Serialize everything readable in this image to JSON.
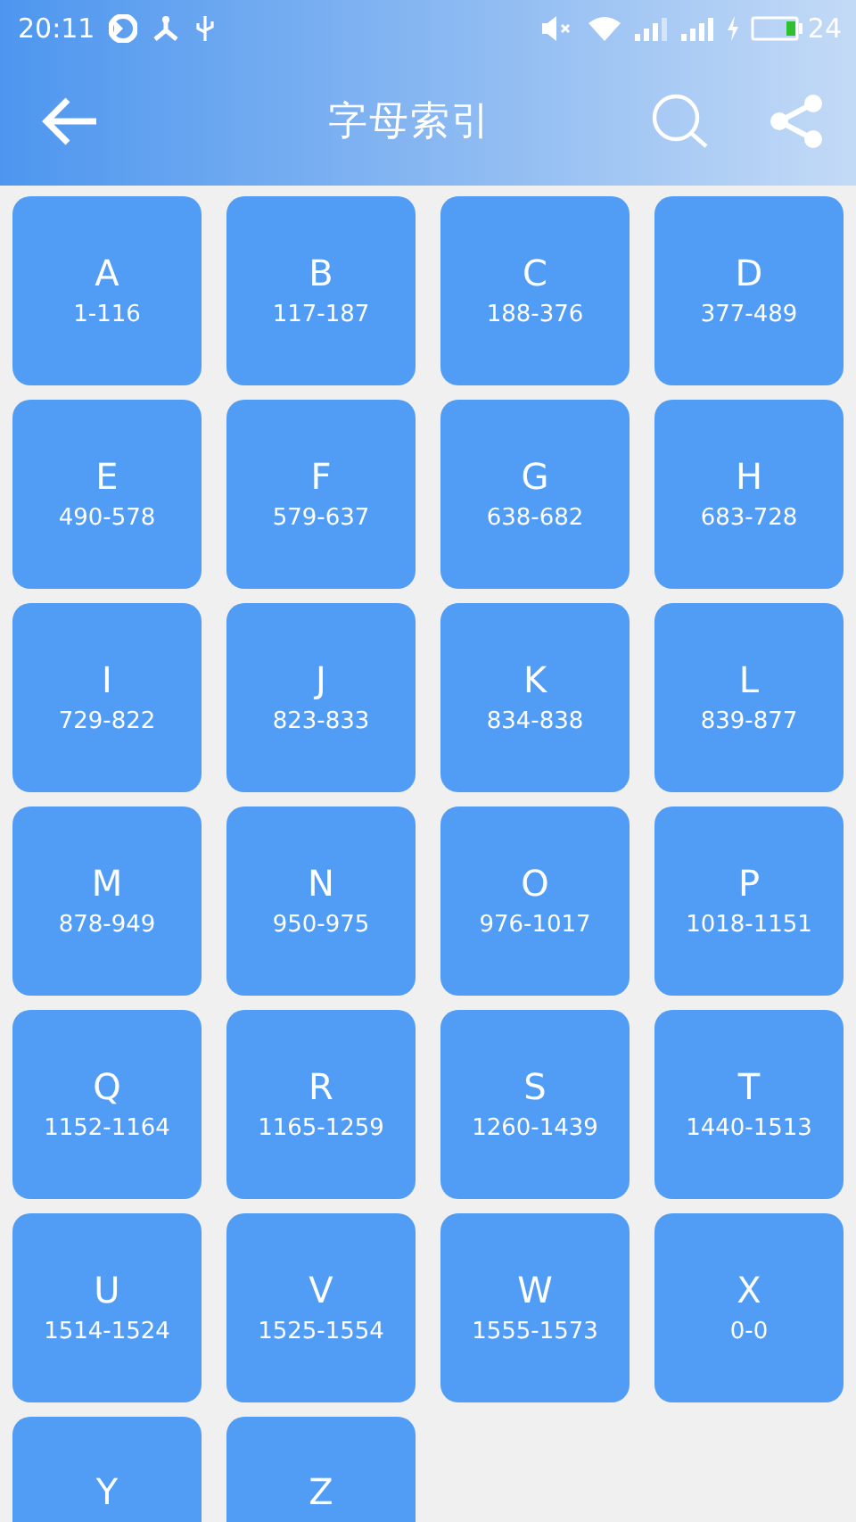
{
  "status_bar": {
    "time": "20:11",
    "battery_percent": "24"
  },
  "header": {
    "title": "字母索引"
  },
  "tiles": [
    {
      "letter": "A",
      "range": "1-116"
    },
    {
      "letter": "B",
      "range": "117-187"
    },
    {
      "letter": "C",
      "range": "188-376"
    },
    {
      "letter": "D",
      "range": "377-489"
    },
    {
      "letter": "E",
      "range": "490-578"
    },
    {
      "letter": "F",
      "range": "579-637"
    },
    {
      "letter": "G",
      "range": "638-682"
    },
    {
      "letter": "H",
      "range": "683-728"
    },
    {
      "letter": "I",
      "range": "729-822"
    },
    {
      "letter": "J",
      "range": "823-833"
    },
    {
      "letter": "K",
      "range": "834-838"
    },
    {
      "letter": "L",
      "range": "839-877"
    },
    {
      "letter": "M",
      "range": "878-949"
    },
    {
      "letter": "N",
      "range": "950-975"
    },
    {
      "letter": "O",
      "range": "976-1017"
    },
    {
      "letter": "P",
      "range": "1018-1151"
    },
    {
      "letter": "Q",
      "range": "1152-1164"
    },
    {
      "letter": "R",
      "range": "1165-1259"
    },
    {
      "letter": "S",
      "range": "1260-1439"
    },
    {
      "letter": "T",
      "range": "1440-1513"
    },
    {
      "letter": "U",
      "range": "1514-1524"
    },
    {
      "letter": "V",
      "range": "1525-1554"
    },
    {
      "letter": "W",
      "range": "1555-1573"
    },
    {
      "letter": "X",
      "range": "0-0"
    },
    {
      "letter": "Y"
    },
    {
      "letter": "Z"
    }
  ]
}
